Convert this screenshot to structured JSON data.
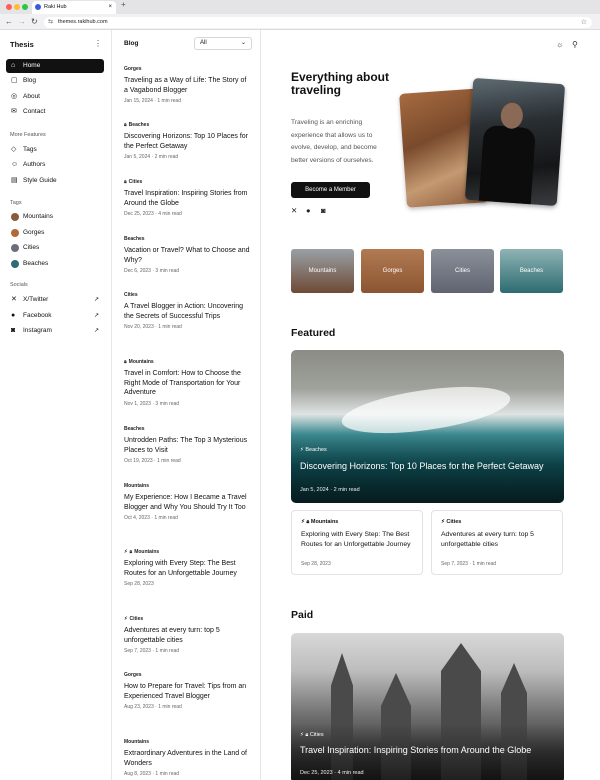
{
  "browser": {
    "tab_title": "Raki Hub",
    "url": "themes.rakihub.com",
    "new_tab": "+",
    "tab_close": "×"
  },
  "sidebar": {
    "brand": "Thesis",
    "items": [
      {
        "label": "Home",
        "icon": "home-icon"
      },
      {
        "label": "Blog",
        "icon": "blog-icon"
      },
      {
        "label": "About",
        "icon": "about-icon"
      },
      {
        "label": "Contact",
        "icon": "mail-icon"
      }
    ],
    "more_heading": "More Features",
    "more": [
      {
        "label": "Tags",
        "icon": "tag-icon"
      },
      {
        "label": "Authors",
        "icon": "users-icon"
      },
      {
        "label": "Style Guide",
        "icon": "document-icon"
      }
    ],
    "tags_heading": "Tags",
    "tags": [
      {
        "label": "Mountains",
        "color": "#8a5a3c"
      },
      {
        "label": "Gorges",
        "color": "#b06a3a"
      },
      {
        "label": "Cities",
        "color": "#6b6f7a"
      },
      {
        "label": "Beaches",
        "color": "#2f6b74"
      }
    ],
    "socials_heading": "Socials",
    "socials": [
      {
        "label": "X/Twitter",
        "icon": "x-icon"
      },
      {
        "label": "Facebook",
        "icon": "facebook-icon"
      },
      {
        "label": "Instagram",
        "icon": "instagram-icon"
      }
    ]
  },
  "blog": {
    "title": "Blog",
    "filter_value": "All",
    "posts": [
      {
        "category": "Gorges",
        "title": "Traveling as a Way of Life: The Story of a Vagabond Blogger",
        "date": "Jan 15, 2024",
        "read": "1 min read"
      },
      {
        "category": "Beaches",
        "title": "Discovering Horizons: Top 10 Places for the Perfect Getaway",
        "date": "Jan 5, 2024",
        "read": "2 min read"
      },
      {
        "category": "Cities",
        "title": "Travel Inspiration: Inspiring Stories from Around the Globe",
        "date": "Dec 25, 2023",
        "read": "4 min read"
      },
      {
        "category": "Beaches",
        "title": "Vacation or Travel? What to Choose and Why?",
        "date": "Dec 6, 2023",
        "read": "3 min read"
      },
      {
        "category": "Cities",
        "title": "A Travel Blogger in Action: Uncovering the Secrets of Successful Trips",
        "date": "Nov 20, 2023",
        "read": "1 min read"
      },
      {
        "category": "Mountains",
        "title": "Travel in Comfort: How to Choose the Right Mode of Transportation for Your Adventure",
        "date": "Nov 1, 2023",
        "read": "3 min read"
      },
      {
        "category": "Beaches",
        "title": "Untrodden Paths: The Top 3 Mysterious Places to Visit",
        "date": "Oct 19, 2023",
        "read": "1 min read"
      },
      {
        "category": "Mountains",
        "title": "My Experience: How I Became a Travel Blogger and Why You Should Try It Too",
        "date": "Oct 4, 2023",
        "read": "1 min read"
      },
      {
        "category": "Mountains",
        "title": "Exploring with Every Step: The Best Routes for an Unforgettable Journey",
        "date": "Sep 28, 2023",
        "read": ""
      },
      {
        "category": "Cities",
        "title": "Adventures at every turn: top 5 unforgettable cities",
        "date": "Sep 7, 2023",
        "read": "1 min read"
      },
      {
        "category": "Gorges",
        "title": "How to Prepare for Travel: Tips from an Experienced Travel Blogger",
        "date": "Aug 23, 2023",
        "read": "1 min read"
      },
      {
        "category": "Mountains",
        "title": "Extraordinary Adventures in the Land of Wonders",
        "date": "Aug 8, 2023",
        "read": "1 min read"
      }
    ]
  },
  "hero": {
    "heading": "Everything about traveling",
    "body": "Traveling is an enriching experience that allows us to evolve, develop, and become better versions of ourselves.",
    "cta": "Become a Member"
  },
  "tag_cards": [
    {
      "label": "Mountains",
      "color": "#6e4a35"
    },
    {
      "label": "Gorges",
      "color": "#8c5532"
    },
    {
      "label": "Cities",
      "color": "#5f6470"
    },
    {
      "label": "Beaches",
      "color": "#2c6c72"
    }
  ],
  "featured": {
    "heading": "Featured",
    "main": {
      "category": "Beaches",
      "title": "Discovering Horizons: Top 10 Places for the Perfect Getaway",
      "date": "Jan 5, 2024",
      "read": "2 min read"
    },
    "cards": [
      {
        "category": "Mountains",
        "title": "Exploring with Every Step: The Best Routes for an Unforgettable Journey",
        "date": "Sep 28, 2023"
      },
      {
        "category": "Cities",
        "title": "Adventures at every turn: top 5 unforgettable cities",
        "date": "Sep 7, 2023",
        "read": "1 min read"
      }
    ]
  },
  "paid": {
    "heading": "Paid",
    "main": {
      "category": "Cities",
      "title": "Travel Inspiration: Inspiring Stories from Around the Globe",
      "date": "Dec 25, 2023",
      "read": "4 min read"
    }
  }
}
